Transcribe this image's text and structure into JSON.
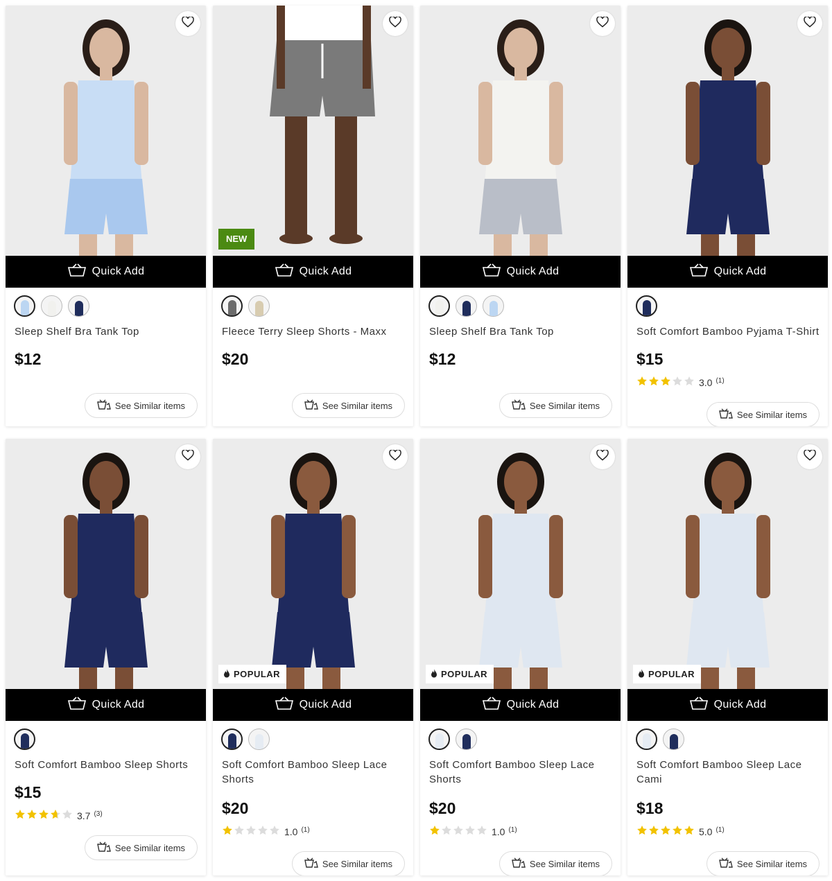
{
  "common": {
    "quick_add_label": "Quick Add",
    "see_similar_label": "See Similar items",
    "new_badge": "NEW",
    "popular_badge": "POPULAR"
  },
  "products": [
    {
      "name": "Sleep Shelf Bra Tank Top",
      "price": "$12",
      "badge": "",
      "rating": null,
      "review_count": "",
      "swatch_colors": [
        "#bcd6f2",
        "#f1f1ee",
        "#1f2d5c"
      ],
      "top_color": "#c8ddf5",
      "bottom_color": "#a9c8ee",
      "skin": "#d9b8a0",
      "hair": "#2a1e18"
    },
    {
      "name": "Fleece Terry Sleep Shorts - Maxx",
      "price": "$20",
      "badge": "new",
      "rating": null,
      "review_count": "",
      "swatch_colors": [
        "#6b6b6b",
        "#d8ccb0"
      ],
      "top_color": "#ffffff",
      "bottom_color": "#7a7a7a",
      "skin": "#5a3a28",
      "hair": "#1a1a1a"
    },
    {
      "name": "Sleep Shelf Bra Tank Top",
      "price": "$12",
      "badge": "",
      "rating": null,
      "review_count": "",
      "swatch_colors": [
        "#f1f1ee",
        "#1f2d5c",
        "#bcd6f2"
      ],
      "top_color": "#f3f3f0",
      "bottom_color": "#b9bec8",
      "skin": "#d9b8a0",
      "hair": "#2a1e18"
    },
    {
      "name": "Soft Comfort Bamboo Pyjama T-Shirt",
      "price": "$15",
      "badge": "",
      "rating": "3.0",
      "rating_value": 3.0,
      "review_count": "(1)",
      "swatch_colors": [
        "#1f2d5c"
      ],
      "top_color": "#1f2a5e",
      "bottom_color": "#1f2a5e",
      "skin": "#7a4e36",
      "hair": "#1a1410"
    },
    {
      "name": "Soft Comfort Bamboo Sleep Shorts",
      "price": "$15",
      "badge": "",
      "rating": "3.7",
      "rating_value": 3.7,
      "review_count": "(3)",
      "swatch_colors": [
        "#1f2d5c"
      ],
      "top_color": "#1f2a5e",
      "bottom_color": "#1f2a5e",
      "skin": "#7a4e36",
      "hair": "#1a1410"
    },
    {
      "name": "Soft Comfort Bamboo Sleep Lace Shorts",
      "price": "$20",
      "badge": "popular",
      "rating": "1.0",
      "rating_value": 1.0,
      "review_count": "(1)",
      "swatch_colors": [
        "#1f2d5c",
        "#e6ecf3"
      ],
      "top_color": "#1f2a5e",
      "bottom_color": "#1f2a5e",
      "skin": "#8a5a3e",
      "hair": "#1a1410"
    },
    {
      "name": "Soft Comfort Bamboo Sleep Lace Shorts",
      "price": "$20",
      "badge": "popular",
      "rating": "1.0",
      "rating_value": 1.0,
      "review_count": "(1)",
      "swatch_colors": [
        "#e6ecf3",
        "#1f2d5c"
      ],
      "top_color": "#dfe7f1",
      "bottom_color": "#dfe7f1",
      "skin": "#8a5a3e",
      "hair": "#1a1410"
    },
    {
      "name": "Soft Comfort Bamboo Sleep Lace Cami",
      "price": "$18",
      "badge": "popular",
      "rating": "5.0",
      "rating_value": 5.0,
      "review_count": "(1)",
      "swatch_colors": [
        "#e6ecf3",
        "#1f2d5c"
      ],
      "top_color": "#dfe7f1",
      "bottom_color": "#dfe7f1",
      "skin": "#8a5a3e",
      "hair": "#1a1410"
    }
  ]
}
